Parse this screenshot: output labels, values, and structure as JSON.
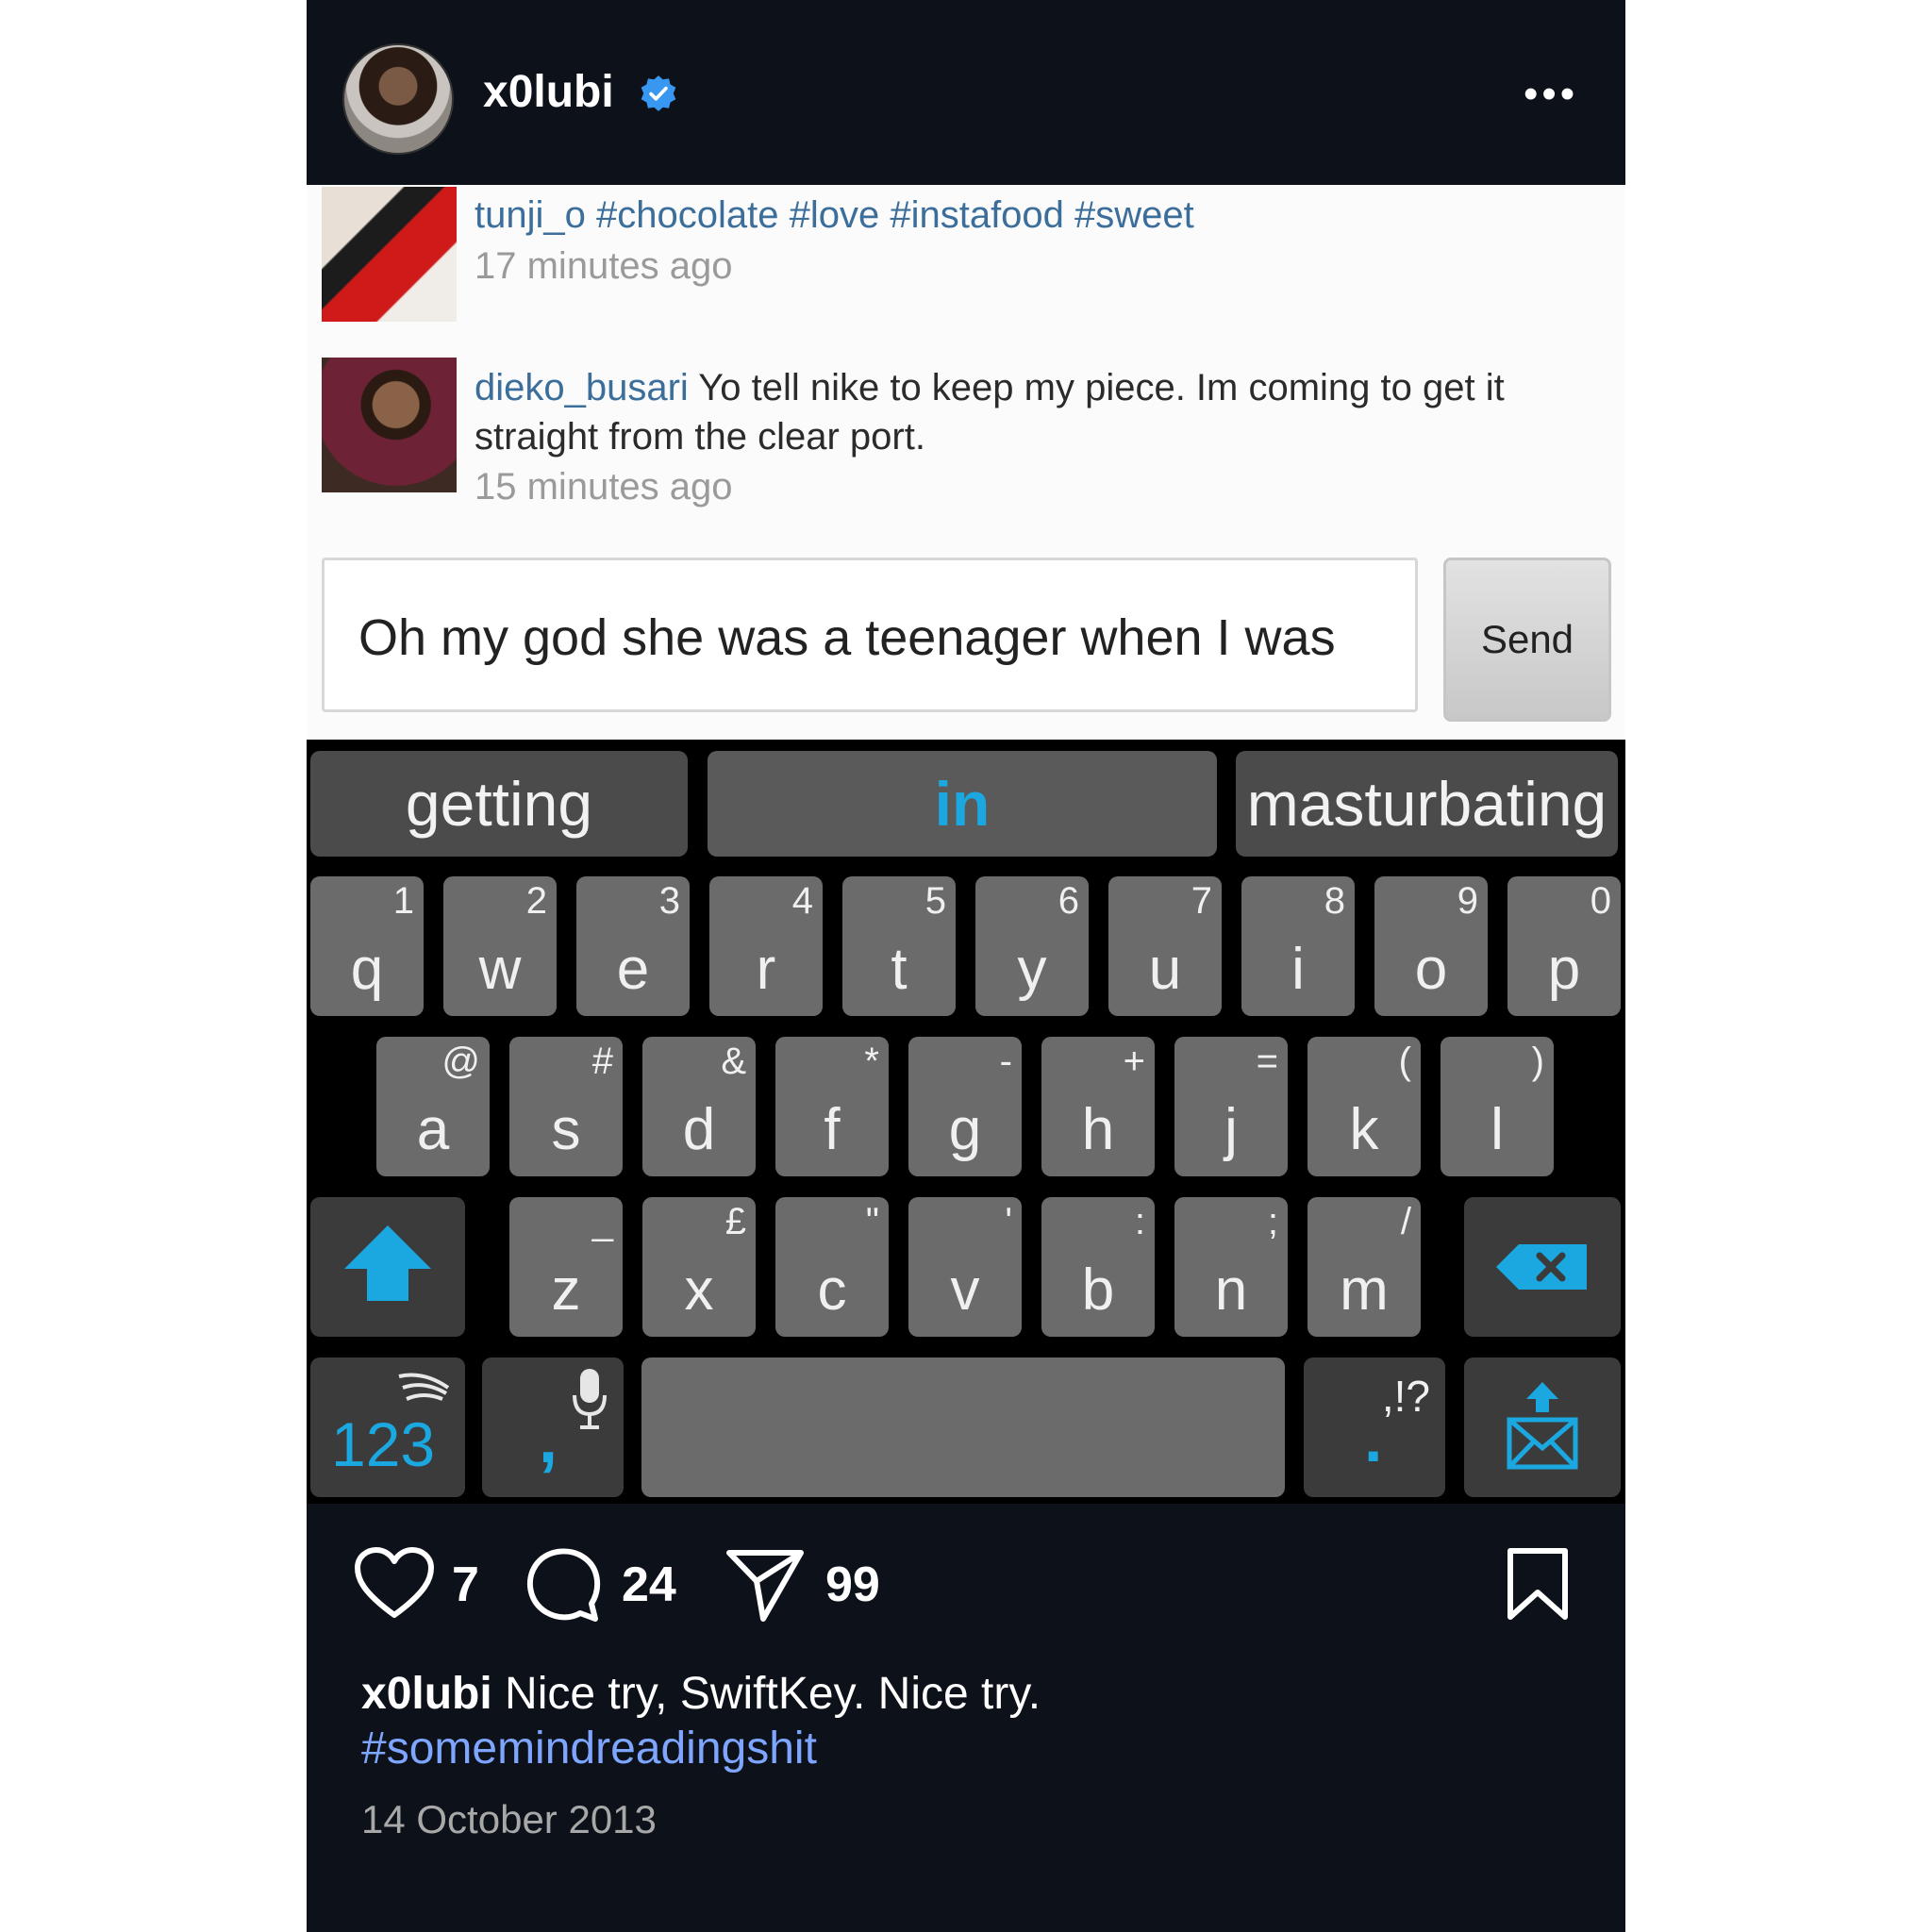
{
  "post": {
    "username": "x0lubi",
    "more_label": "•••"
  },
  "comments": [
    {
      "user": "tunji_o",
      "text": "#chocolate #love #instafood #sweet",
      "time": "17 minutes ago"
    },
    {
      "user": "dieko_busari",
      "text": "Yo tell nike to keep my piece. Im coming to get it straight from the clear port.",
      "time": "15 minutes ago"
    }
  ],
  "comment_box": {
    "value": "Oh my god she was a teenager when I was",
    "send_label": "Send"
  },
  "keyboard": {
    "suggestions": [
      "getting",
      "in",
      "masturbating"
    ],
    "row1": [
      {
        "ch": "q",
        "alt": "1"
      },
      {
        "ch": "w",
        "alt": "2"
      },
      {
        "ch": "e",
        "alt": "3"
      },
      {
        "ch": "r",
        "alt": "4"
      },
      {
        "ch": "t",
        "alt": "5"
      },
      {
        "ch": "y",
        "alt": "6"
      },
      {
        "ch": "u",
        "alt": "7"
      },
      {
        "ch": "i",
        "alt": "8"
      },
      {
        "ch": "o",
        "alt": "9"
      },
      {
        "ch": "p",
        "alt": "0"
      }
    ],
    "row2": [
      {
        "ch": "a",
        "alt": "@"
      },
      {
        "ch": "s",
        "alt": "#"
      },
      {
        "ch": "d",
        "alt": "&"
      },
      {
        "ch": "f",
        "alt": "*"
      },
      {
        "ch": "g",
        "alt": "-"
      },
      {
        "ch": "h",
        "alt": "+"
      },
      {
        "ch": "j",
        "alt": "="
      },
      {
        "ch": "k",
        "alt": "("
      },
      {
        "ch": "l",
        "alt": ")"
      }
    ],
    "row3": [
      {
        "ch": "z",
        "alt": "_"
      },
      {
        "ch": "x",
        "alt": "£"
      },
      {
        "ch": "c",
        "alt": "\""
      },
      {
        "ch": "v",
        "alt": "'"
      },
      {
        "ch": "b",
        "alt": ":"
      },
      {
        "ch": "n",
        "alt": ";"
      },
      {
        "ch": "m",
        "alt": "/"
      }
    ],
    "numbers_label": "123",
    "comma_label": ",",
    "punct_label": ",!?",
    "period_label": ".",
    "accent_color": "#1ba8e0"
  },
  "actions": {
    "likes": "7",
    "comments": "24",
    "shares": "99"
  },
  "caption": {
    "user": "x0lubi",
    "text": "Nice try, SwiftKey. Nice try.",
    "hashtag": "#somemindreadingshit",
    "date": "14 October 2013"
  }
}
